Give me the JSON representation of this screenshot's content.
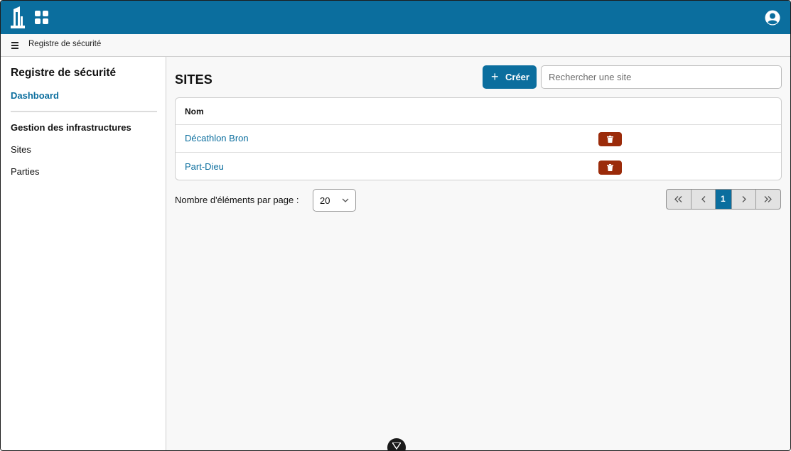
{
  "colors": {
    "brand": "#0b6e9e",
    "danger": "#9b2b0a",
    "background": "#f8f8f8"
  },
  "header": {
    "logo_icon": "building-logo-icon",
    "apps_icon": "apps-grid-icon",
    "user_icon": "user-account-icon"
  },
  "breadcrumb": {
    "menu_icon": "hamburger-menu-icon",
    "text": "Registre de sécurité"
  },
  "sidebar": {
    "title": "Registre de sécurité",
    "dashboard": "Dashboard",
    "section": "Gestion des infrastructures",
    "items": [
      {
        "label": "Sites"
      },
      {
        "label": "Parties"
      }
    ]
  },
  "main": {
    "title": "SITES",
    "create_label": "Créer",
    "create_icon": "plus-icon",
    "search_placeholder": "Rechercher une site",
    "table": {
      "column_name": "Nom",
      "rows": [
        {
          "name": "Décathlon Bron"
        },
        {
          "name": "Part-Dieu"
        }
      ],
      "delete_icon": "trash-icon"
    },
    "pagination": {
      "per_page_label": "Nombre d'éléments par page :",
      "per_page_value": "20",
      "current_page": "1"
    }
  }
}
